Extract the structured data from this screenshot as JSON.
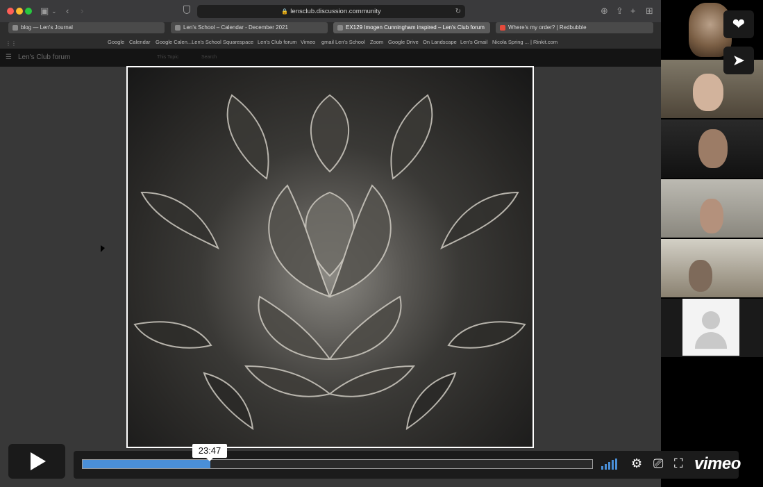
{
  "browser": {
    "url": "lensclub.discussion.community",
    "tabs": [
      {
        "label": "blog — Len's Journal",
        "active": false
      },
      {
        "label": "Len's School – Calendar - December 2021",
        "active": false
      },
      {
        "label": "EX129 Imogen Cunningham inspired – Len's Club forum",
        "active": true
      },
      {
        "label": "Where's my order? | Redbubble",
        "active": false
      }
    ],
    "bookmarks": [
      "Google",
      "Calendar",
      "Google Calen...Len's School",
      "Squarespace",
      "Len's Club forum",
      "Vimeo",
      "gmail Len's School",
      "Zoom",
      "Google Drive",
      "On Landscape",
      "Len's Gmail",
      "Nicola Spring ... | Rinkit.com"
    ]
  },
  "forum": {
    "title": "Len's Club forum",
    "search_scope": "This Topic",
    "search_label": "Search"
  },
  "player": {
    "time_tooltip": "23:47",
    "progress": 0.25,
    "brand": "vimeo"
  },
  "colors": {
    "progress": "#4a8fd8",
    "tooltip_bg": "#ffffff"
  }
}
